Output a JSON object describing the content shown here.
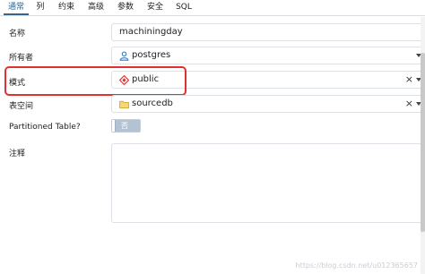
{
  "tabs": [
    {
      "label": "通常",
      "active": true
    },
    {
      "label": "列",
      "active": false
    },
    {
      "label": "约束",
      "active": false
    },
    {
      "label": "高级",
      "active": false
    },
    {
      "label": "参数",
      "active": false
    },
    {
      "label": "安全",
      "active": false
    },
    {
      "label": "SQL",
      "active": false
    }
  ],
  "form": {
    "name": {
      "label": "名称",
      "value": "machiningday"
    },
    "owner": {
      "label": "所有者",
      "value": "postgres",
      "icon": "user-icon"
    },
    "schema": {
      "label": "模式",
      "value": "public",
      "icon": "schema-icon",
      "clear": "×"
    },
    "tablespace": {
      "label": "表空间",
      "value": "sourcedb",
      "icon": "folder-icon",
      "clear": "×"
    },
    "partitioned": {
      "label": "Partitioned Table?",
      "toggle_text": "否"
    },
    "comment": {
      "label": "注释",
      "value": ""
    }
  },
  "watermark": "https://blog.csdn.net/u012365657",
  "colors": {
    "accent": "#326690",
    "highlight": "#e03131",
    "toggle_off": "#b3c3d4",
    "border": "#dde0e6"
  }
}
